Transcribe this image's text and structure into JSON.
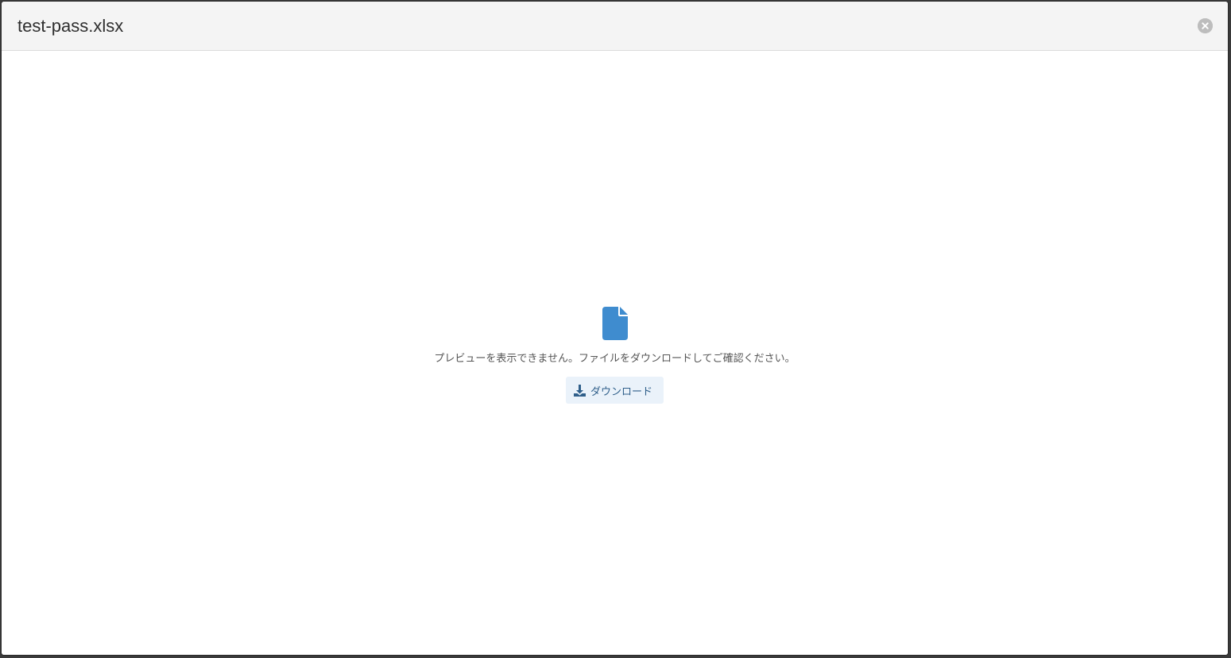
{
  "modal": {
    "title": "test-pass.xlsx",
    "close_icon": "close-circle-icon"
  },
  "preview": {
    "file_icon": "file-icon",
    "message": "プレビューを表示できません。ファイルをダウンロードしてご確認ください。",
    "download_label": "ダウンロード",
    "download_icon": "download-icon"
  },
  "colors": {
    "accent": "#3f8ccf",
    "button_bg": "#eaf2fa",
    "button_text": "#2f5f8a",
    "header_bg": "#f4f4f4"
  }
}
